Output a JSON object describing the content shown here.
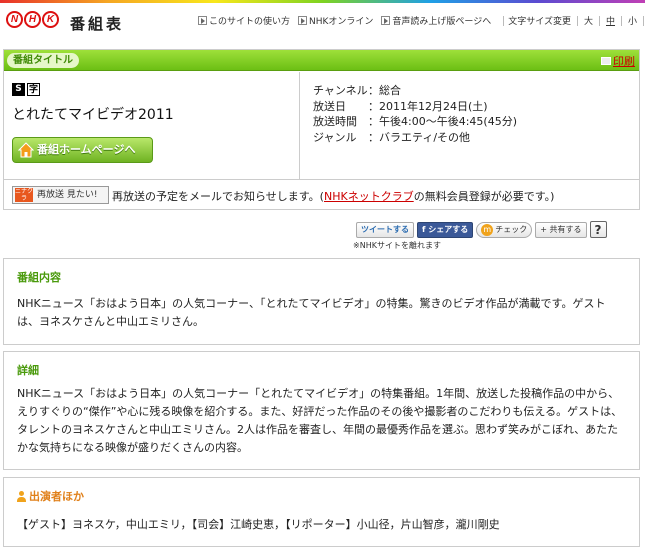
{
  "header": {
    "logo_letters": [
      "N",
      "H",
      "K"
    ],
    "site_title": "番組表",
    "links": [
      "このサイトの使い方",
      "NHKオンライン",
      "音声読み上げ版ページへ"
    ],
    "font_size_label": "文字サイズ変更",
    "sizes": [
      "大",
      "中",
      "小"
    ],
    "active_size": "中"
  },
  "program": {
    "bar_label": "番組タイトル",
    "print_label": "印刷",
    "marks": [
      "S",
      "字"
    ],
    "title": "とれたてマイビデオ2011",
    "home_button": "番組ホームページへ",
    "info": [
      {
        "key": "チャンネル",
        "value": "：総合"
      },
      {
        "key": "放送日",
        "value": "：2011年12月24日(土)"
      },
      {
        "key": "放送時間",
        "value": "：午後4:00〜午後4:45(45分)"
      },
      {
        "key": "ジャンル",
        "value": "：バラエティ/その他"
      }
    ],
    "rebroadcast": {
      "icon_text": "ニナクラ",
      "button_label": "再放送 見たい!",
      "text_before": "再放送の予定をメールでお知らせします。(",
      "link": "NHKネットクラブ",
      "text_after": "の無料会員登録が必要です。)"
    }
  },
  "social": {
    "tweet": "ツイートする",
    "share": "シェアする",
    "check": "チェック",
    "kyoyu": "共有する",
    "help": "?",
    "note": "※NHKサイトを離れます"
  },
  "sections": {
    "content": {
      "heading": "番組内容",
      "text": "NHKニュース「おはよう日本」の人気コーナー、「とれたてマイビデオ」の特集。驚きのビデオ作品が満載です。ゲストは、ヨネスケさんと中山エミリさん。"
    },
    "detail": {
      "heading": "詳細",
      "text": "NHKニュース「おはよう日本」の人気コーナー「とれたてマイビデオ」の特集番組。1年間、放送した投稿作品の中から、えりすぐりの“傑作”や心に残る映像を紹介する。また、好評だった作品のその後や撮影者のこだわりも伝える。ゲストは、タレントのヨネスケさんと中山エミリさん。2人は作品を審査し、年間の最優秀作品を選ぶ。思わず笑みがこぼれ、あたたかな気持ちになる映像が盛りだくさんの内容。"
    },
    "cast": {
      "heading": "出演者ほか",
      "text": "【ゲスト】ヨネスケ，中山エミリ，【司会】江崎史恵，【リポーター】小山径，片山智彦，瀧川剛史"
    }
  },
  "colors": {
    "green": "#6cbf14",
    "link_red": "#c00",
    "heading_green": "#4a9a0c",
    "heading_orange": "#e0801a"
  }
}
